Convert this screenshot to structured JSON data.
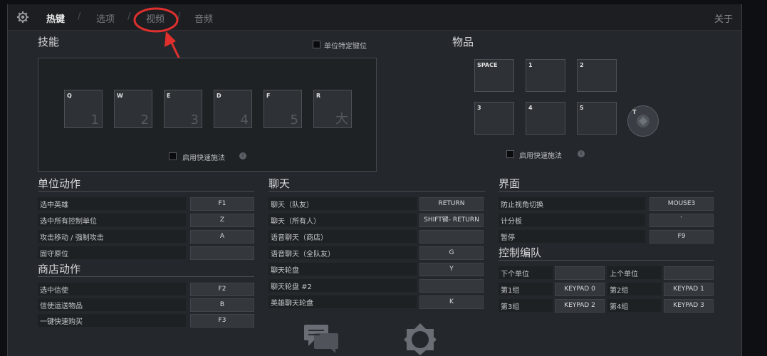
{
  "topbar": {
    "tabs": [
      {
        "label": "热键",
        "active": true
      },
      {
        "label": "选项",
        "active": false
      },
      {
        "label": "视频",
        "active": false
      },
      {
        "label": "音频",
        "active": false
      }
    ],
    "about": "关于"
  },
  "skills": {
    "title": "技能",
    "unit_specific": "单位特定键位",
    "keys": [
      {
        "key": "Q",
        "num": "1"
      },
      {
        "key": "W",
        "num": "2"
      },
      {
        "key": "E",
        "num": "3"
      },
      {
        "key": "D",
        "num": "4"
      },
      {
        "key": "F",
        "num": "5"
      },
      {
        "key": "R",
        "num": "大"
      }
    ],
    "quickcast": "启用快速施法",
    "info": "i"
  },
  "items": {
    "title": "物品",
    "slots": [
      "SPACE",
      "1",
      "2",
      "3",
      "4",
      "5"
    ],
    "tp_key": "T",
    "quickcast": "启用快速施法",
    "info": "i"
  },
  "unit_actions": {
    "title": "单位动作",
    "rows": [
      {
        "label": "选中英雄",
        "key": "F1"
      },
      {
        "label": "选中所有控制单位",
        "key": "Z"
      },
      {
        "label": "攻击移动 / 强制攻击",
        "key": "A"
      },
      {
        "label": "固守原位",
        "key": ""
      }
    ]
  },
  "shop_actions": {
    "title": "商店动作",
    "rows": [
      {
        "label": "选中信使",
        "key": "F2"
      },
      {
        "label": "信使运送物品",
        "key": "B"
      },
      {
        "label": "一键快速购买",
        "key": "F3"
      }
    ]
  },
  "chat": {
    "title": "聊天",
    "rows": [
      {
        "label": "聊天（队友）",
        "key": "RETURN"
      },
      {
        "label": "聊天（所有人）",
        "key": "SHIFT键- RETURN"
      },
      {
        "label": "语音聊天（商店）",
        "key": ""
      },
      {
        "label": "语音聊天（全队友）",
        "key": "G"
      },
      {
        "label": "聊天轮盘",
        "key": "Y"
      },
      {
        "label": "聊天轮盘 #2",
        "key": ""
      },
      {
        "label": "英雄聊天轮盘",
        "key": "K"
      }
    ]
  },
  "interface": {
    "title": "界面",
    "rows": [
      {
        "label": "防止视角切换",
        "key": "MOUSE3"
      },
      {
        "label": "计分板",
        "key": "`"
      },
      {
        "label": "暂停",
        "key": "F9"
      }
    ]
  },
  "control_groups": {
    "title": "控制编队",
    "rows": [
      {
        "l1": "下个单位",
        "k1": "",
        "l2": "上个单位",
        "k2": ""
      },
      {
        "l1": "第1组",
        "k1": "KEYPAD 0",
        "l2": "第2组",
        "k2": "KEYPAD 1"
      },
      {
        "l1": "第3组",
        "k1": "KEYPAD 2",
        "l2": "第4组",
        "k2": "KEYPAD 3"
      }
    ]
  }
}
